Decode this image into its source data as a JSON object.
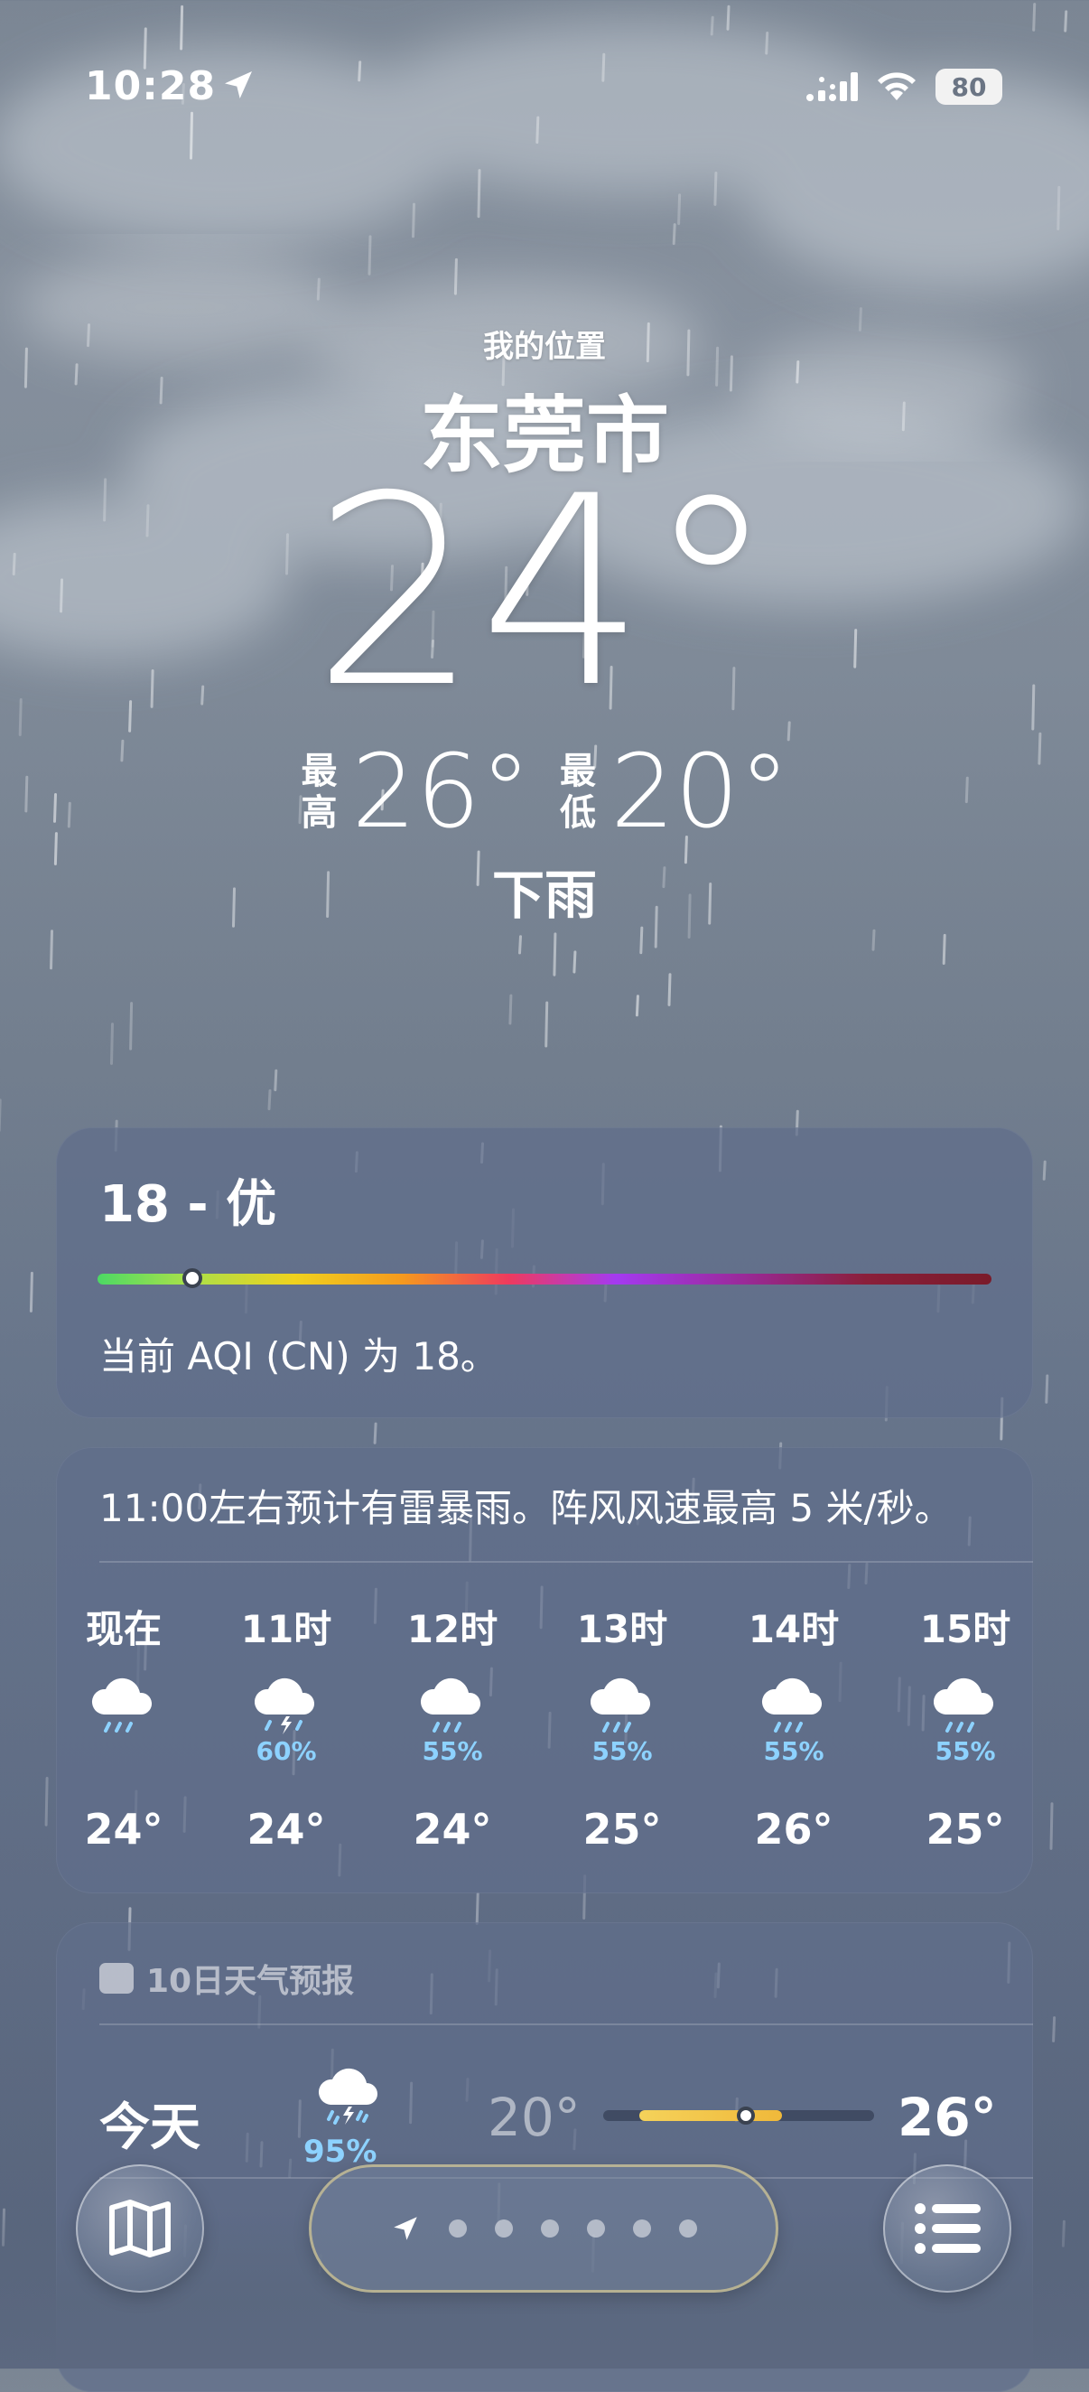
{
  "status_bar": {
    "time": "10:28",
    "battery": "80",
    "icons": [
      "location-arrow-icon",
      "cellular-signal-icon",
      "wifi-icon",
      "battery-icon"
    ]
  },
  "location": {
    "label": "我的位置",
    "city": "东莞市",
    "temperature": "24°",
    "high_label": "最高",
    "high_value": "26°",
    "low_label": "最低",
    "low_value": "20°",
    "condition": "下雨"
  },
  "aqi": {
    "title": "18 - 优",
    "description": "当前 AQI (CN) 为 18。",
    "level": 18
  },
  "hourly": {
    "summary": "11:00左右预计有雷暴雨。阵风风速最高 5 米/秒。",
    "items": [
      {
        "label": "现在",
        "icon": "cloud-rain-icon",
        "prob": "",
        "temp": "24°"
      },
      {
        "label": "11时",
        "icon": "cloud-bolt-rain-icon",
        "prob": "60%",
        "temp": "24°"
      },
      {
        "label": "12时",
        "icon": "cloud-rain-icon",
        "prob": "55%",
        "temp": "24°"
      },
      {
        "label": "13时",
        "icon": "cloud-rain-icon",
        "prob": "55%",
        "temp": "25°"
      },
      {
        "label": "14时",
        "icon": "cloud-rain-icon",
        "prob": "55%",
        "temp": "26°"
      },
      {
        "label": "15时",
        "icon": "cloud-rain-icon",
        "prob": "55%",
        "temp": "25°"
      }
    ]
  },
  "daily": {
    "header": "10日天气预报",
    "rows": [
      {
        "day": "今天",
        "icon": "cloud-bolt-rain-icon",
        "prob": "95%",
        "low": "20°",
        "high": "26°",
        "current_level": 24
      }
    ]
  },
  "bottom_bar": {
    "left_button": "map-icon",
    "right_button": "list-icon",
    "page_count": 7,
    "current_page": 0
  },
  "colors": {
    "precip_blue": "#8dd2ff",
    "temp_bar_yellow": "#f0c040",
    "card_bg": "rgba(96,110,138,.72)"
  }
}
